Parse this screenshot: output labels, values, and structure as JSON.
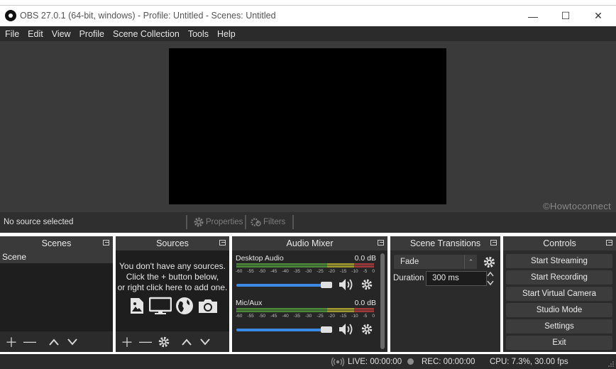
{
  "window": {
    "title": "OBS 27.0.1 (64-bit, windows) - Profile: Untitled - Scenes: Untitled",
    "minimize": "—",
    "maximize": "☐",
    "close": "✕"
  },
  "menu": [
    "File",
    "Edit",
    "View",
    "Profile",
    "Scene Collection",
    "Tools",
    "Help"
  ],
  "preview": {
    "watermark": "©Howtoconnect"
  },
  "context_bar": {
    "selection": "No source selected",
    "properties": "Properties",
    "filters": "Filters"
  },
  "scenes": {
    "title": "Scenes",
    "items": [
      "Scene"
    ]
  },
  "sources": {
    "title": "Sources",
    "empty_line1": "You don't have any sources.",
    "empty_line2": "Click the + button below,",
    "empty_line3": "or right click here to add one."
  },
  "mixer": {
    "title": "Audio Mixer",
    "scale": [
      "-60",
      "-55",
      "-50",
      "-45",
      "-40",
      "-35",
      "-30",
      "-25",
      "-20",
      "-15",
      "-10",
      "-5",
      "0"
    ],
    "tracks": [
      {
        "name": "Desktop Audio",
        "db": "0.0 dB",
        "volume": 1.0
      },
      {
        "name": "Mic/Aux",
        "db": "0.0 dB",
        "volume": 1.0
      }
    ]
  },
  "transitions": {
    "title": "Scene Transitions",
    "selected": "Fade",
    "duration_label": "Duration",
    "duration_value": "300 ms"
  },
  "controls": {
    "title": "Controls",
    "buttons": [
      "Start Streaming",
      "Start Recording",
      "Start Virtual Camera",
      "Studio Mode",
      "Settings",
      "Exit"
    ]
  },
  "status": {
    "live": "LIVE: 00:00:00",
    "rec": "REC: 00:00:00",
    "cpu": "CPU: 7.3%, 30.00 fps"
  },
  "colors": {
    "meter_green": "#4c8a3a",
    "meter_yellow": "#a09a30",
    "meter_red": "#a03a3a",
    "volume_blue": "#3d8ae6"
  }
}
